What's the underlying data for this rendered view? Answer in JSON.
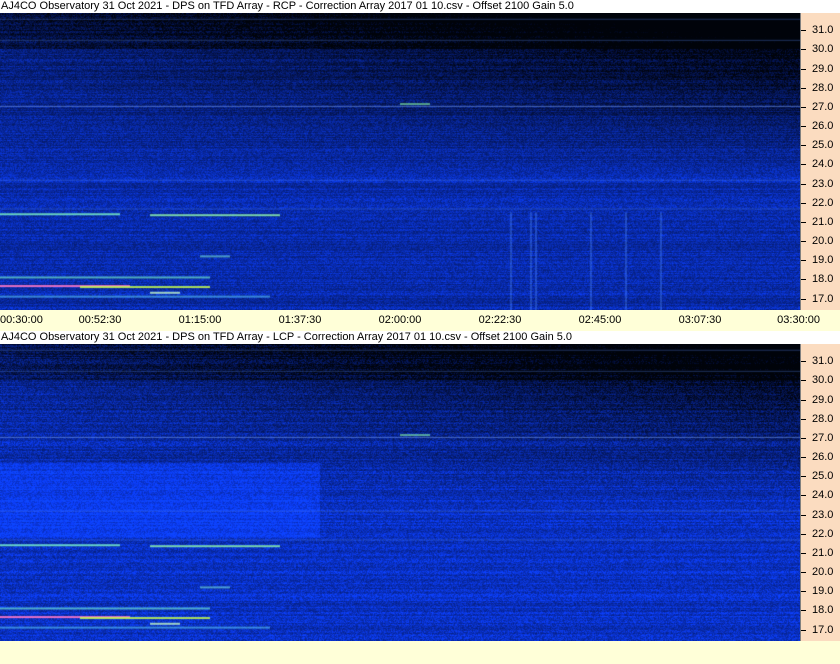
{
  "chart_data": [
    {
      "type": "heatmap",
      "title": "AJ4CO Observatory 31 Oct 2021  -  DPS on TFD Array  -  RCP  -  Correction Array 2017 01 10.csv  -  Offset 2100  Gain 5.0",
      "polarization": "RCP",
      "y_ticks": [
        "31.0",
        "30.0",
        "29.0",
        "28.0",
        "27.0",
        "26.0",
        "25.0",
        "24.0",
        "23.0",
        "22.0",
        "21.0",
        "20.0",
        "19.0",
        "18.0",
        "17.0"
      ],
      "x_ticks": [
        "00:30:00",
        "00:52:30",
        "01:15:00",
        "01:37:30",
        "02:00:00",
        "02:22:30",
        "02:45:00",
        "03:07:30",
        "03:30:00"
      ],
      "ylim": [
        16.4,
        31.9
      ],
      "xlim": [
        "00:30:00",
        "03:30:00"
      ],
      "colors": {
        "background": "#0a2fd0",
        "dark": "#000830",
        "bright": "#3a8cff"
      }
    },
    {
      "type": "heatmap",
      "title": "AJ4CO Observatory 31 Oct 2021  -  DPS on TFD Array  -  LCP  -  Correction Array 2017 01 10.csv  -  Offset 2100  Gain 5.0",
      "polarization": "LCP",
      "y_ticks": [
        "31.0",
        "30.0",
        "29.0",
        "28.0",
        "27.0",
        "26.0",
        "25.0",
        "24.0",
        "23.0",
        "22.0",
        "21.0",
        "20.0",
        "19.0",
        "18.0",
        "17.0"
      ],
      "x_ticks": [],
      "ylim": [
        16.4,
        31.9
      ],
      "xlim": [
        "00:30:00",
        "03:30:00"
      ],
      "colors": {
        "background": "#0a2fd0",
        "dark": "#000830",
        "bright": "#3a8cff"
      }
    }
  ]
}
